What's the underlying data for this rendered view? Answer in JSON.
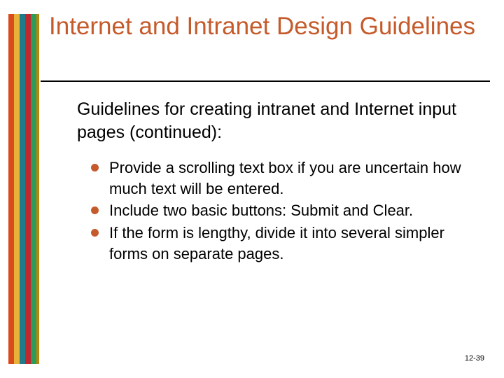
{
  "title": "Internet and Intranet Design Guidelines",
  "subtitle": "Guidelines for creating intranet and Internet input pages (continued):",
  "bullets": [
    "Provide a scrolling text box if you are uncertain how much text will be entered.",
    "Include two basic buttons: Submit and Clear.",
    "If the form is lengthy, divide it into several simpler forms on separate pages."
  ],
  "footer": "12-39"
}
